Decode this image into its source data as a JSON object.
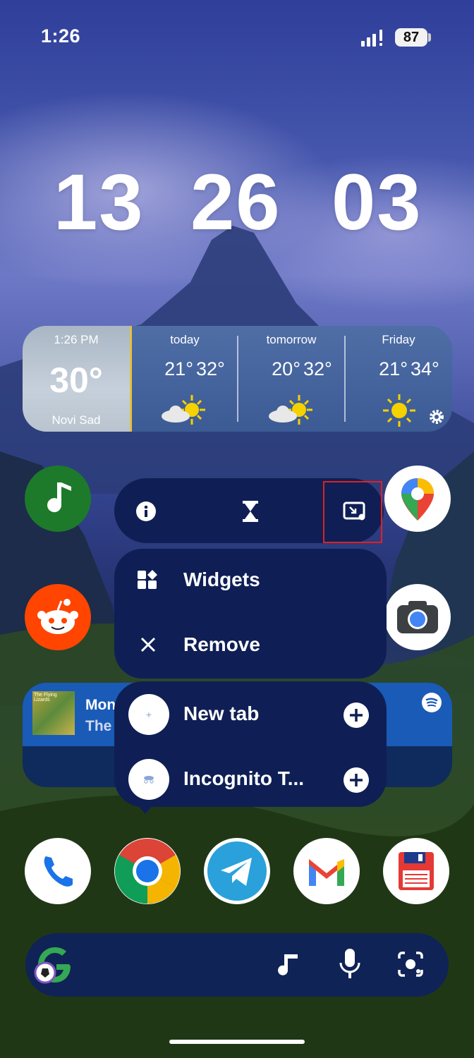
{
  "status_bar": {
    "time": "1:26",
    "battery": "87"
  },
  "clock": {
    "hours": "13",
    "minutes": "26",
    "seconds": "03"
  },
  "weather": {
    "current": {
      "time": "1:26 PM",
      "temp": "30°",
      "location": "Novi Sad"
    },
    "days": [
      {
        "label": "today",
        "low": "21°",
        "high": "32°",
        "icon": "partly-sunny-icon"
      },
      {
        "label": "tomorrow",
        "low": "20°",
        "high": "32°",
        "icon": "partly-sunny-icon"
      },
      {
        "label": "Friday",
        "low": "21°",
        "high": "34°",
        "icon": "sunny-icon"
      }
    ]
  },
  "popup": {
    "actions": [
      "info-icon",
      "hourglass-icon",
      "picture-in-picture-icon"
    ],
    "menu": [
      {
        "label": "Widgets",
        "icon": "widgets-icon"
      },
      {
        "label": "Remove",
        "icon": "close-icon"
      }
    ],
    "shortcuts": [
      {
        "label": "New tab",
        "icon": "new-tab-icon"
      },
      {
        "label": "Incognito T...",
        "icon": "incognito-icon"
      }
    ]
  },
  "spotify": {
    "title": "Mon",
    "artist": "The",
    "album_text": "The Flying Lizards"
  },
  "dock": [
    "phone",
    "chrome",
    "telegram",
    "gmail",
    "save"
  ],
  "colors": {
    "menu_bg": "#0f1f55",
    "highlight": "#e02020",
    "sun": "#f5d100"
  }
}
